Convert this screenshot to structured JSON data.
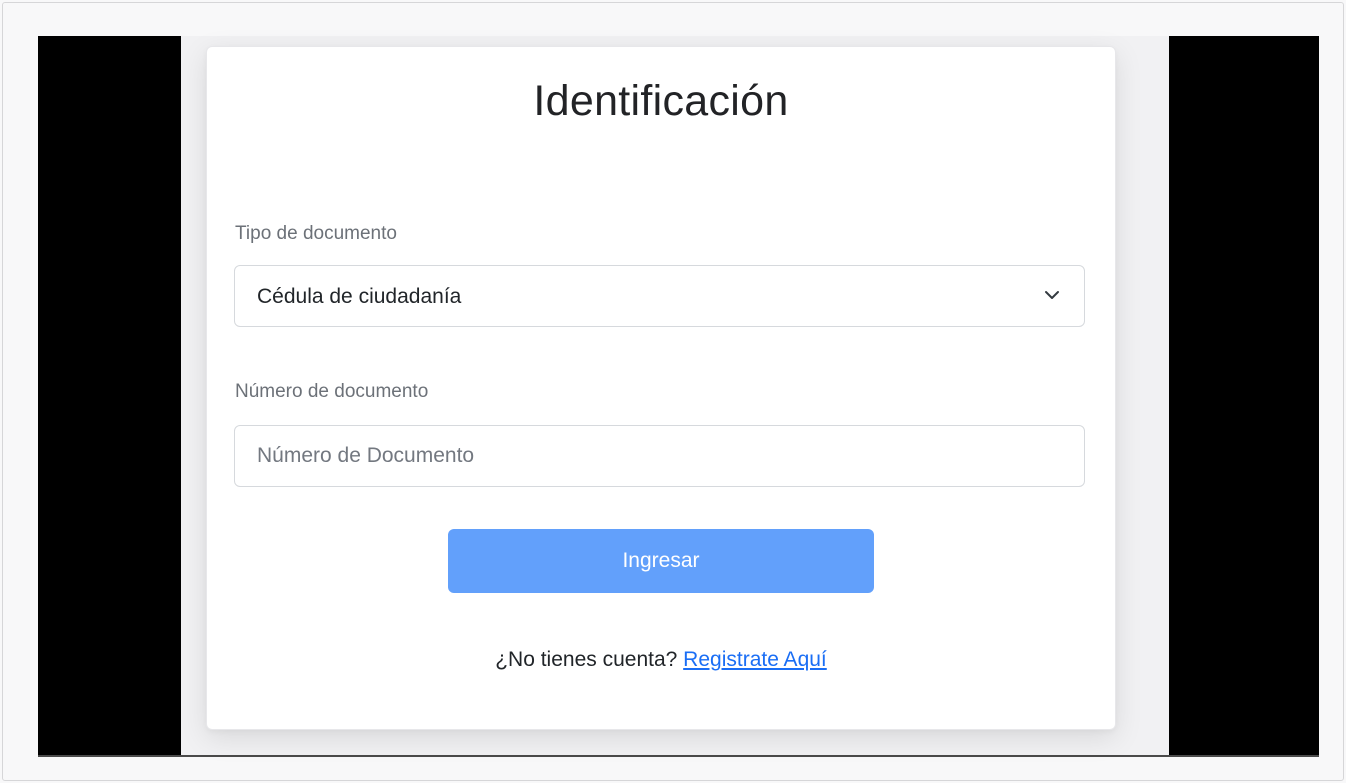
{
  "login": {
    "title": "Identificación",
    "document_type": {
      "label": "Tipo de documento",
      "selected": "Cédula de ciudadanía"
    },
    "document_number": {
      "label": "Número de documento",
      "placeholder": "Número de Documento",
      "value": ""
    },
    "submit_label": "Ingresar",
    "register_prompt": "¿No tienes cuenta?",
    "register_link": "Registrate Aquí"
  },
  "colors": {
    "button": "#62a0fb",
    "link": "#1a6ef5"
  },
  "icons": {
    "select_arrow": "chevron-down-icon"
  }
}
